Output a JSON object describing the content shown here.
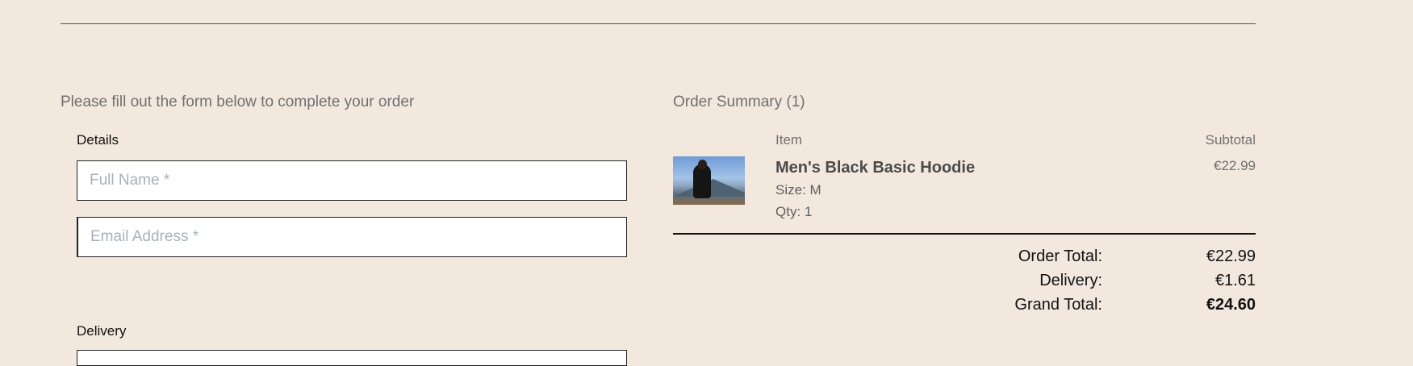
{
  "form": {
    "intro": "Please fill out the form below to complete your order",
    "details_label": "Details",
    "full_name_placeholder": "Full Name *",
    "email_placeholder": "Email Address *",
    "delivery_label": "Delivery"
  },
  "summary": {
    "title": "Order Summary (1)",
    "col_item": "Item",
    "col_subtotal": "Subtotal",
    "items": [
      {
        "name": "Men's Black Basic Hoodie",
        "size": "Size: M",
        "qty": "Qty: 1",
        "subtotal": "€22.99",
        "image_icon": "product-thumbnail"
      }
    ],
    "totals": {
      "order_total_label": "Order Total:",
      "order_total_value": "€22.99",
      "delivery_label": "Delivery:",
      "delivery_value": "€1.61",
      "grand_total_label": "Grand Total:",
      "grand_total_value": "€24.60"
    }
  },
  "colors": {
    "background": "#f2e8de",
    "muted_text": "#707070",
    "placeholder": "#a7b1bb"
  }
}
